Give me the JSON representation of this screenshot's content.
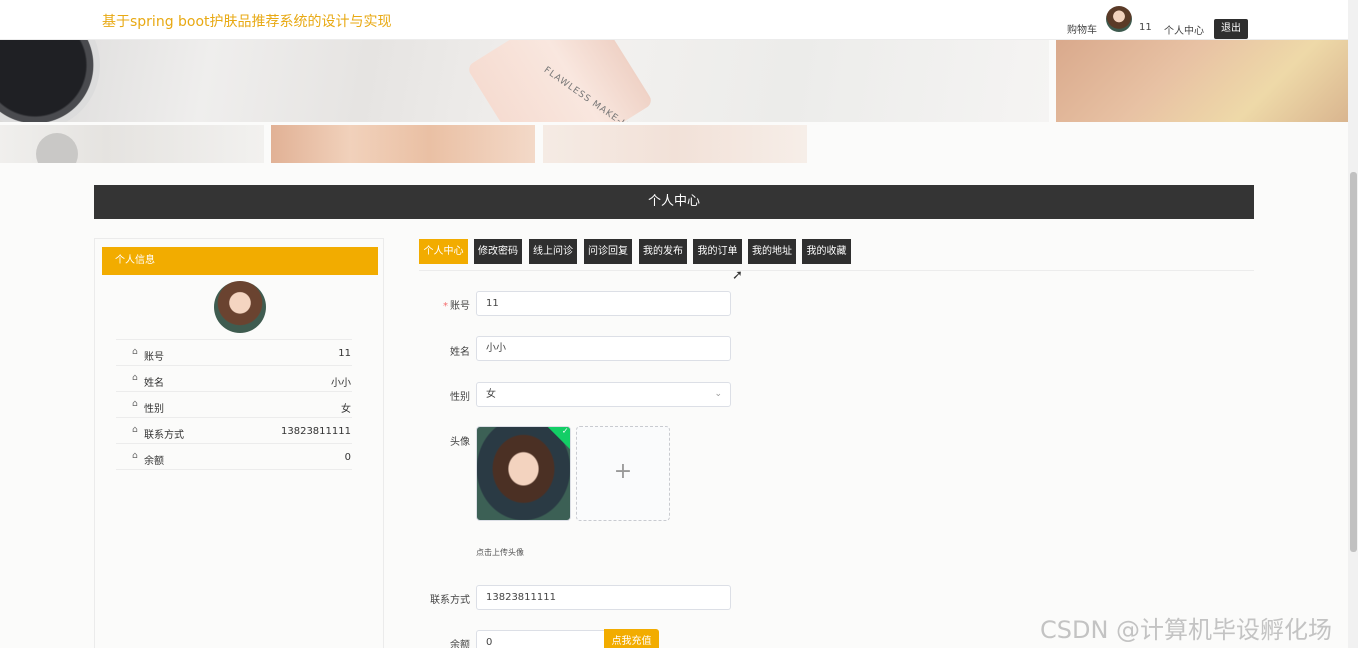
{
  "header": {
    "title": "基于spring boot护肤品推荐系统的设计与实现",
    "cart_label": "购物车",
    "username": "11",
    "center_label": "个人中心",
    "logout_label": "退出"
  },
  "banner": {
    "tube_text": "FLAWLESS MAKE-UP"
  },
  "section_title": "个人中心",
  "profile": {
    "header": "个人信息",
    "rows": [
      {
        "label": "账号",
        "value": "11"
      },
      {
        "label": "姓名",
        "value": "小小"
      },
      {
        "label": "性别",
        "value": "女"
      },
      {
        "label": "联系方式",
        "value": "13823811111"
      },
      {
        "label": "余额",
        "value": "0"
      }
    ]
  },
  "tabs": [
    {
      "label": "个人中心",
      "active": true
    },
    {
      "label": "修改密码"
    },
    {
      "label": "线上问诊"
    },
    {
      "label": "问诊回复"
    },
    {
      "label": "我的发布"
    },
    {
      "label": "我的订单"
    },
    {
      "label": "我的地址"
    },
    {
      "label": "我的收藏"
    }
  ],
  "form": {
    "account_label": "账号",
    "account_value": "11",
    "name_label": "姓名",
    "name_value": "小小",
    "gender_label": "性别",
    "gender_value": "女",
    "avatar_label": "头像",
    "upload_tip": "点击上传头像",
    "phone_label": "联系方式",
    "phone_value": "13823811111",
    "balance_label": "余额",
    "balance_value": "0",
    "recharge_label": "点我充值"
  },
  "watermark": "CSDN @计算机毕设孵化场",
  "colors": {
    "accent": "#f2ac00",
    "dark": "#343434",
    "title": "#e8a913"
  }
}
